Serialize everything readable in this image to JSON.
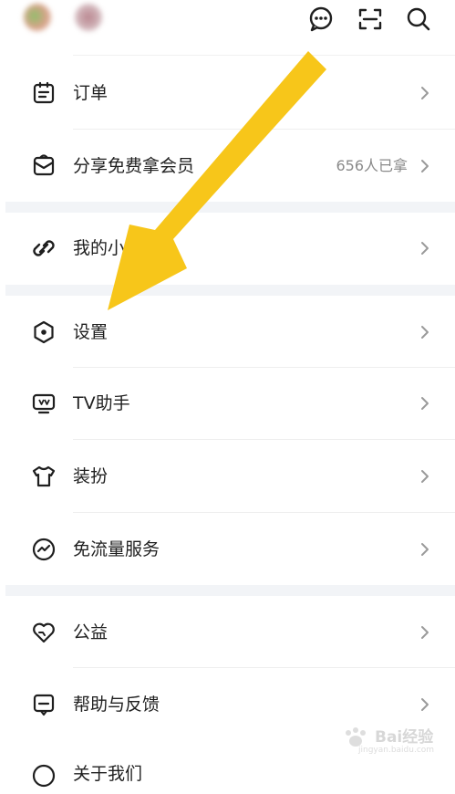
{
  "menu": {
    "orders": {
      "label": "订单"
    },
    "share": {
      "label": "分享免费拿会员",
      "extra": "656人已拿"
    },
    "mini_program": {
      "label": "我的小程序"
    },
    "settings": {
      "label": "设置"
    },
    "tv_helper": {
      "label": "TV助手"
    },
    "dress_up": {
      "label": "装扮"
    },
    "free_data": {
      "label": "免流量服务"
    },
    "charity": {
      "label": "公益"
    },
    "help": {
      "label": "帮助与反馈"
    },
    "about": {
      "label": "关于我们"
    }
  },
  "top_icons": [
    "message-bubble-icon",
    "scan-icon",
    "search-icon"
  ],
  "colors": {
    "accent_arrow": "#f7c61a",
    "divider_band": "#f2f4f7",
    "text": "#1f1f1f",
    "muted": "#8a8a8a"
  },
  "watermark": {
    "text": "Bai经验",
    "sub": "jingyan.baidu.com"
  }
}
